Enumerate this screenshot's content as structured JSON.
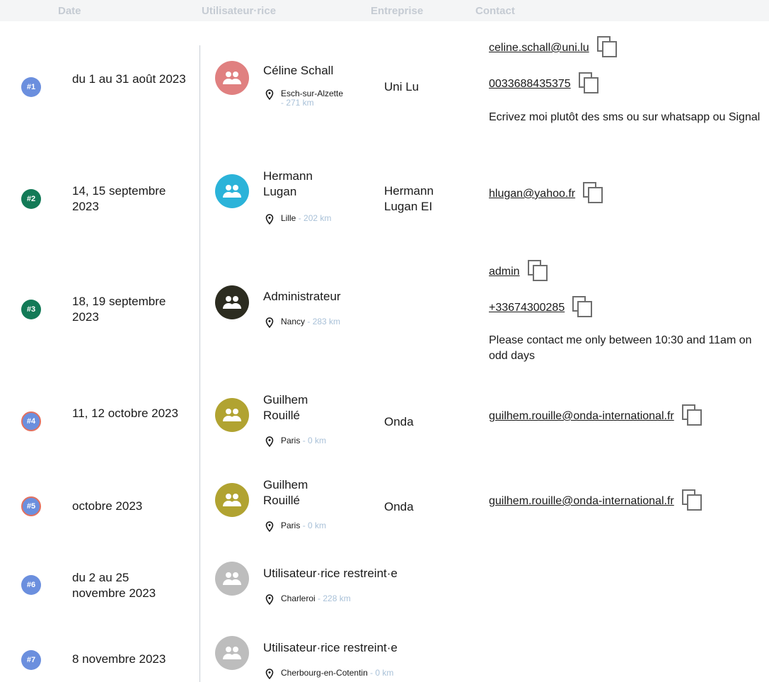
{
  "header": {
    "date": "Date",
    "user": "Utilisateur·rice",
    "company": "Entreprise",
    "contact": "Contact"
  },
  "rows": [
    {
      "badge": "#1",
      "badge_color": "#6b8fde",
      "badge_ring": false,
      "date": "du 1 au 31 août 2023",
      "avatar_color": "#e08080",
      "name": "Céline Schall",
      "location": "Esch-sur-Alzette",
      "distance": "- 271 km",
      "company": "Uni Lu",
      "email": "celine.schall@uni.lu",
      "phone": "0033688435375",
      "note": "Ecrivez moi plutôt des sms ou sur whatsapp ou Signal"
    },
    {
      "badge": "#2",
      "badge_color": "#137a57",
      "badge_ring": false,
      "date": "14, 15 septembre 2023",
      "avatar_color": "#2bb3d9",
      "name": "Hermann Lugan",
      "location": "Lille",
      "distance": "- 202 km",
      "company": "Hermann Lugan EI",
      "email": "hlugan@yahoo.fr"
    },
    {
      "badge": "#3",
      "badge_color": "#137a57",
      "badge_ring": false,
      "date": "18, 19 septembre 2023",
      "avatar_color": "#2c2c20",
      "name": "Administrateur",
      "location": "Nancy",
      "distance": "- 283 km",
      "email": "admin",
      "phone": "+33674300285",
      "note": "Please contact me only between 10:30 and 11am on odd days"
    },
    {
      "badge": "#4",
      "badge_color": "#6b8fde",
      "badge_ring": true,
      "date": "11, 12 octobre 2023",
      "avatar_color": "#b1a331",
      "name": "Guilhem Rouillé",
      "location": "Paris",
      "distance": "- 0 km",
      "company": "Onda",
      "email": "guilhem.rouille@onda-international.fr"
    },
    {
      "badge": "#5",
      "badge_color": "#6b8fde",
      "badge_ring": true,
      "date": "octobre 2023",
      "avatar_color": "#b1a331",
      "name": "Guilhem Rouillé",
      "location": "Paris",
      "distance": "- 0 km",
      "company": "Onda",
      "email": "guilhem.rouille@onda-international.fr"
    },
    {
      "badge": "#6",
      "badge_color": "#6b8fde",
      "badge_ring": false,
      "date": "du 2 au 25 novembre 2023",
      "avatar_color": "#bdbdbd",
      "name": "Utilisateur·rice restreint·e",
      "location": "Charleroi",
      "distance": "- 228 km"
    },
    {
      "badge": "#7",
      "badge_color": "#6b8fde",
      "badge_ring": false,
      "date": "8 novembre 2023",
      "avatar_color": "#bdbdbd",
      "name": "Utilisateur·rice restreint·e",
      "location": "Cherbourg-en-Cotentin",
      "distance": "- 0 km"
    }
  ]
}
